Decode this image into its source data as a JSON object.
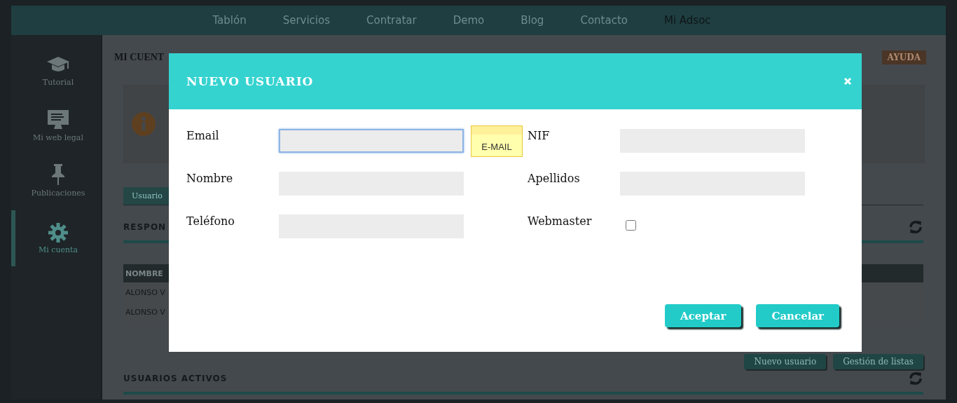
{
  "nav": [
    {
      "label": "Tablón",
      "selected": false
    },
    {
      "label": "Servicios",
      "selected": false
    },
    {
      "label": "Contratar",
      "selected": false
    },
    {
      "label": "Demo",
      "selected": false
    },
    {
      "label": "Blog",
      "selected": false
    },
    {
      "label": "Contacto",
      "selected": false
    },
    {
      "label": "Mi Adsoc",
      "selected": true
    }
  ],
  "sidebar": [
    {
      "label": "Tutorial",
      "selected": false
    },
    {
      "label": "Mi web legal",
      "selected": false
    },
    {
      "label": "Publicaciones",
      "selected": false
    },
    {
      "label": "Mi cuenta",
      "selected": true
    }
  ],
  "page": {
    "title": "MI CUENT",
    "help": "AYUDA",
    "tabs": [
      {
        "label": "Usuario",
        "selected": true
      }
    ],
    "responsables": {
      "title": "RESPON",
      "header": "NOMBRE",
      "rows": [
        "ALONSO V",
        "ALONSO V"
      ]
    },
    "buttons": [
      "Nuevo usuario",
      "Gestión de listas"
    ],
    "active_users": {
      "title": "USUARIOS ACTIVOS"
    }
  },
  "modal": {
    "title": "NUEVO USUARIO",
    "fields": [
      {
        "label": "Email",
        "kind": "text",
        "focused": true,
        "tooltip": "E-MAIL"
      },
      {
        "label": "NIF",
        "kind": "text",
        "focused": false
      },
      {
        "label": "Nombre",
        "kind": "text",
        "focused": false
      },
      {
        "label": "Apellidos",
        "kind": "text",
        "focused": false
      },
      {
        "label": "Teléfono",
        "kind": "text",
        "focused": false
      },
      {
        "label": "Webmaster",
        "kind": "checkbox",
        "checked": false
      }
    ],
    "buttons": [
      "Aceptar",
      "Cancelar"
    ]
  }
}
